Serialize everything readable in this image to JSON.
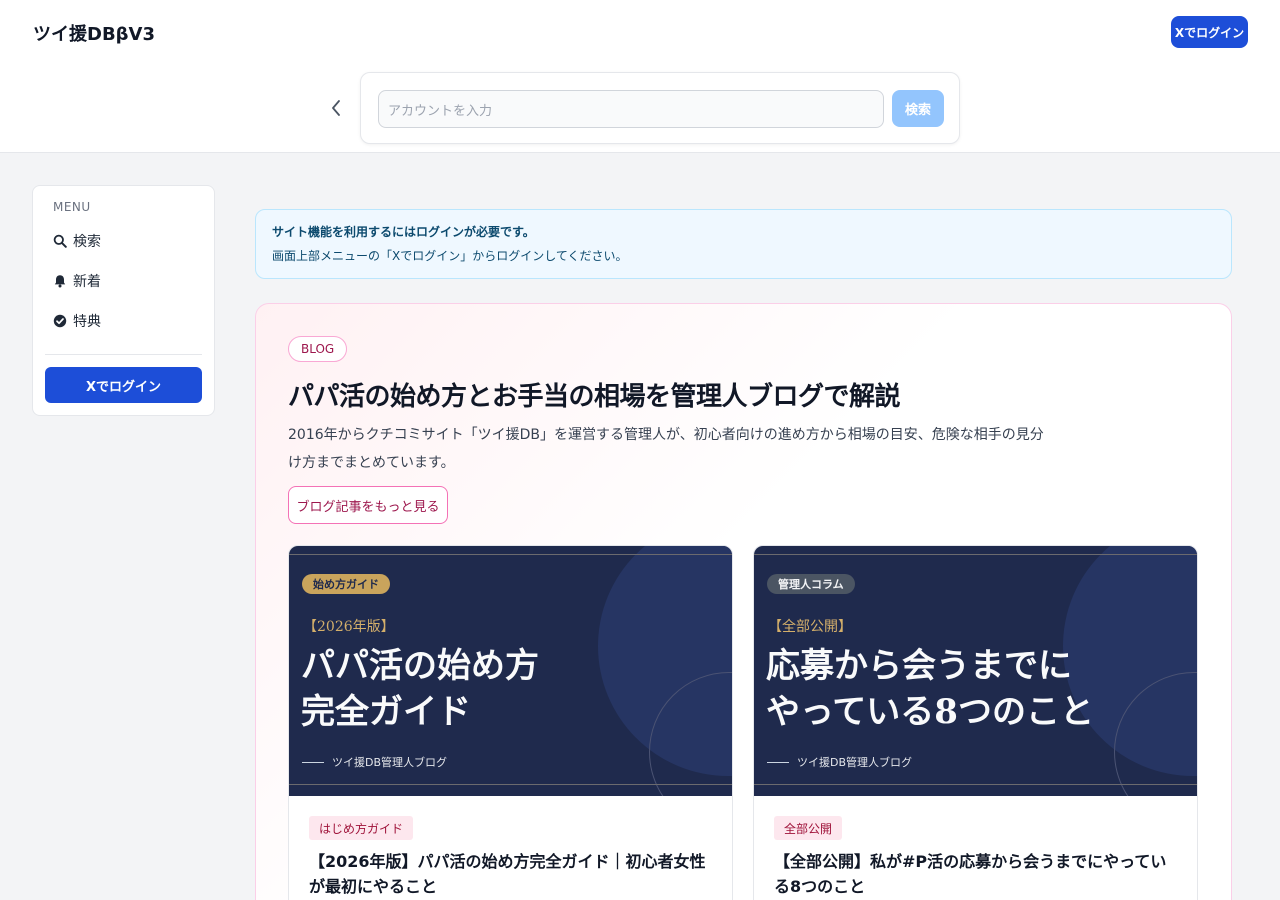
{
  "header": {
    "brand": "ツイ援DBβV3",
    "login_button": "Xでログイン",
    "search": {
      "placeholder": "アカウントを入力",
      "button": "検索"
    }
  },
  "sidebar": {
    "menu_title": "MENU",
    "items": [
      {
        "label": "検索",
        "icon": "search-icon"
      },
      {
        "label": "新着",
        "icon": "bell-icon"
      },
      {
        "label": "特典",
        "icon": "check-badge-icon"
      }
    ],
    "login_button": "Xでログイン"
  },
  "alert": {
    "title": "サイト機能を利用するにはログインが必要です。",
    "body": "画面上部メニューの「Xでログイン」からログインしてください。"
  },
  "blog": {
    "badge": "BLOG",
    "title": "パパ活の始め方とお手当の相場を管理人ブログで解説",
    "description": "2016年からクチコミサイト「ツイ援DB」を運営する管理人が、初心者向けの進め方から相場の目安、危険な相手の見分け方までまとめています。",
    "more_button": "ブログ記事をもっと見る",
    "cards": [
      {
        "thumb_tag": "始め方ガイド",
        "thumb_kicker": "【2026年版】",
        "thumb_title_1": "パパ活の始め方",
        "thumb_title_2": "完全ガイド",
        "thumb_footer": "ツイ援DB管理人ブログ",
        "category": "はじめ方ガイド",
        "title": "【2026年版】パパ活の始め方完全ガイド｜初心者女性が最初にやること"
      },
      {
        "thumb_tag": "管理人コラム",
        "thumb_kicker": "【全部公開】",
        "thumb_title_1": "応募から会うまでに",
        "thumb_title_2": "やっている8つのこと",
        "thumb_footer": "ツイ援DB管理人ブログ",
        "category": "全部公開",
        "title": "【全部公開】私が#P活の応募から会うまでにやっている8つのこと"
      }
    ]
  },
  "colors": {
    "primary": "#1d4ed8",
    "search_button": "#93c5fd",
    "thumb_bg": "#1f2a4d",
    "accent_gold": "#c9a45c",
    "pink_accent": "#9d174d"
  }
}
